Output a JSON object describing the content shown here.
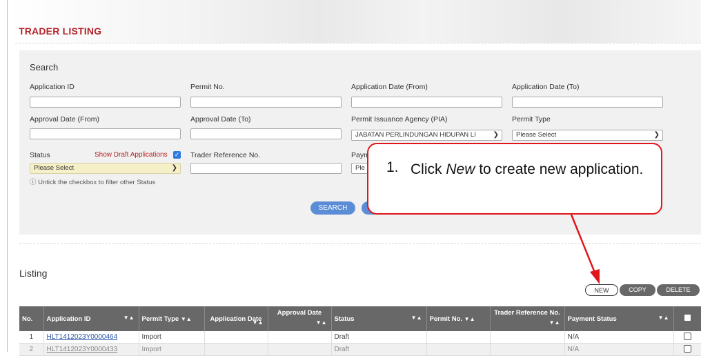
{
  "page_title": "TRADER LISTING",
  "search": {
    "title": "Search",
    "application_id_label": "Application ID",
    "permit_no_label": "Permit No.",
    "app_date_from_label": "Application Date (From)",
    "app_date_to_label": "Application Date (To)",
    "approval_date_from_label": "Approval Date (From)",
    "approval_date_to_label": "Approval Date (To)",
    "pia_label": "Permit Issuance Agency (PIA)",
    "pia_value": "JABATAN PERLINDUNGAN HIDUPAN LI",
    "permit_type_label": "Permit Type",
    "permit_type_value": "Please Select",
    "status_label": "Status",
    "status_value": "Please Select",
    "show_draft_label": "Show Draft Applications",
    "trader_ref_label": "Trader Reference No.",
    "payment_label_partial": "Paym",
    "payment_value_partial": "Ple",
    "hint": "ⓘ Untick the checkbox to filter other Status",
    "search_button": "SEARCH"
  },
  "listing": {
    "title": "Listing",
    "buttons": {
      "new": "NEW",
      "copy": "COPY",
      "delete": "DELETE"
    },
    "columns": [
      "No.",
      "Application ID",
      "Permit Type",
      "Application Date",
      "Approval Date",
      "Status",
      "Permit No.",
      "Trader Reference No.",
      "Payment Status"
    ],
    "rows": [
      {
        "no": "1",
        "app_id": "HLT1412023Y0000464",
        "permit_type": "Import",
        "app_date": "",
        "approval_date": "",
        "status": "Draft",
        "permit_no": "",
        "trader_ref": "",
        "payment": "N/A"
      },
      {
        "no": "2",
        "app_id": "HLT1412023Y0000433",
        "permit_type": "Import",
        "app_date": "",
        "approval_date": "",
        "status": "Draft",
        "permit_no": "",
        "trader_ref": "",
        "payment": "N/A"
      }
    ]
  },
  "callout": {
    "number": "1.",
    "text_before": "Click ",
    "text_italic": "New",
    "text_after": " to create new application."
  },
  "colors": {
    "accent_red": "#b5242a",
    "header_gray": "#686868",
    "button_blue": "#5b8dd6",
    "callout_red": "#e0161b"
  }
}
